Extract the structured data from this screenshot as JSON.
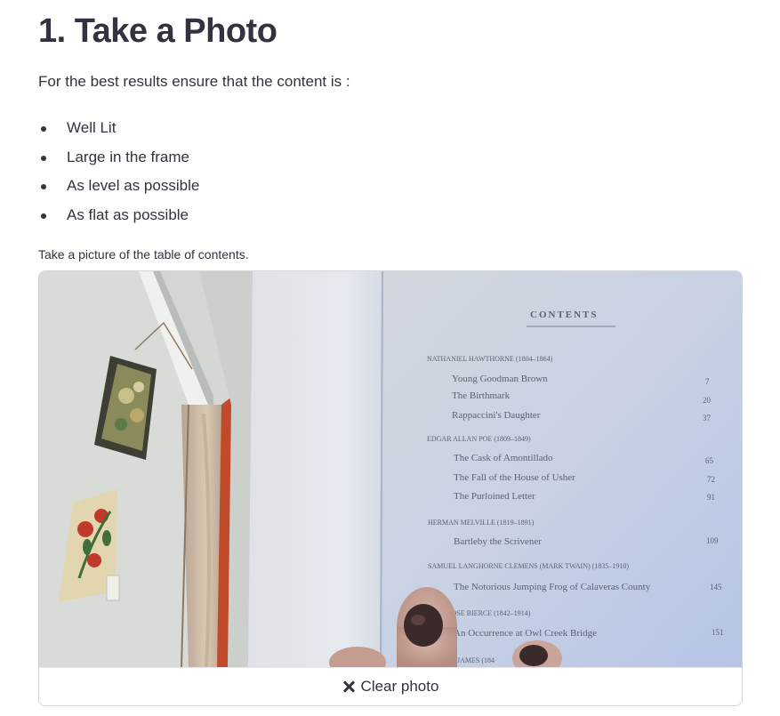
{
  "page": {
    "title": "1. Take a Photo",
    "intro": "For the best results ensure that the content is :",
    "tips": [
      "Well Lit",
      "Large in the frame",
      "As level as possible",
      "As flat as possible"
    ],
    "camera_label": "Take a picture of the table of contents."
  },
  "camera": {
    "clear_label": "Clear photo",
    "clear_icon": "close-icon"
  },
  "photo_text": {
    "heading": "CONTENTS",
    "sections": [
      {
        "author": "NATHANIEL HAWTHORNE (1804–1864)",
        "entries": [
          {
            "title": "Young Goodman Brown",
            "page": "7"
          },
          {
            "title": "The Birthmark",
            "page": "20"
          },
          {
            "title": "Rappaccini's Daughter",
            "page": "37"
          }
        ]
      },
      {
        "author": "EDGAR ALLAN POE (1809–1849)",
        "entries": [
          {
            "title": "The Cask of Amontillado",
            "page": "65"
          },
          {
            "title": "The Fall of the House of Usher",
            "page": "72"
          },
          {
            "title": "The Purloined Letter",
            "page": "91"
          }
        ]
      },
      {
        "author": "HERMAN MELVILLE (1819–1891)",
        "entries": [
          {
            "title": "Bartleby the Scrivener",
            "page": "109"
          }
        ]
      },
      {
        "author": "SAMUEL LANGHORNE CLEMENS (MARK TWAIN) (1835–1910)",
        "entries": [
          {
            "title": "The Notorious Jumping Frog of Calaveras County",
            "page": "145"
          }
        ]
      },
      {
        "author": "AMBROSE BIERCE (1842–1914)",
        "entries": [
          {
            "title": "An Occurrence at Owl Creek Bridge",
            "page": "151"
          }
        ]
      }
    ],
    "partial": "JAMES (184"
  }
}
